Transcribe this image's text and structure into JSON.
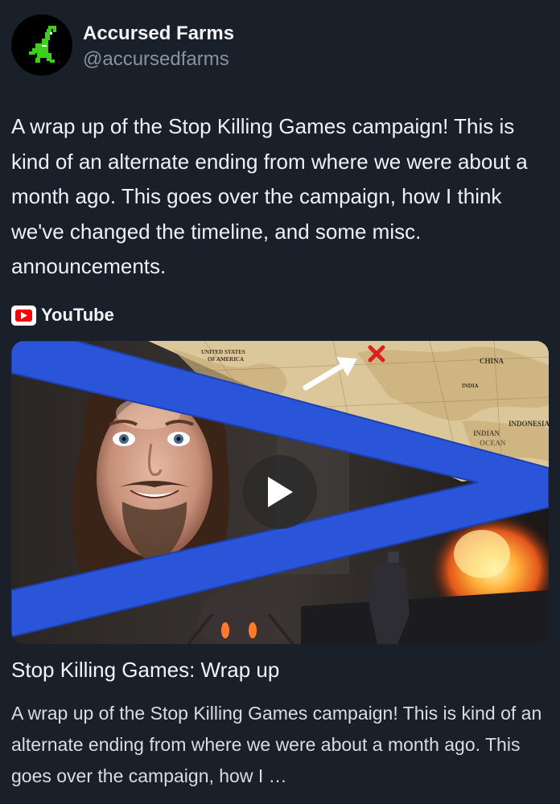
{
  "author": {
    "display_name": "Accursed Farms",
    "handle": "@accursedfarms",
    "avatar_icon": "green-pixel-creature-icon"
  },
  "post": {
    "text": "A wrap up of the Stop Killing Games campaign!  This is kind of an alternate ending from where we were about a month ago.  This goes over the campaign, how I think we've changed the timeline, and some misc. announcements."
  },
  "link_card": {
    "source_name": "YouTube",
    "source_icon": "youtube-logo-icon",
    "play_icon": "play-icon",
    "title": "Stop Killing Games: Wrap up",
    "description": "A wrap up of the Stop Killing Games campaign! This is kind of an alternate ending from where we were about a month ago. This goes over the campaign, how I …",
    "thumbnail_map_labels": {
      "usa": "UNITED STATES OF AMERICA",
      "china": "CHINA",
      "india": "INDIA",
      "indonesia": "INDONESIA",
      "indian": "INDIAN",
      "ocean": "OCEAN"
    }
  },
  "colors": {
    "background": "#19202a",
    "text": "#eef1f5",
    "muted": "#8893a0",
    "accent_blue": "#2a55d8",
    "youtube_red": "#ff0000",
    "map_parchment": "#dcc79b"
  }
}
